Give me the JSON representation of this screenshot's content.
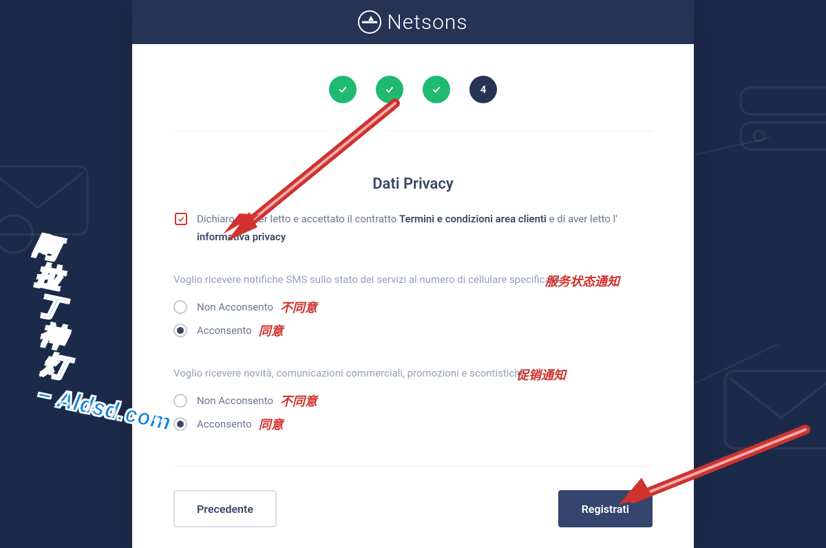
{
  "brand": "Netsons",
  "steps": {
    "current": "4"
  },
  "title": "Dati Privacy",
  "terms": {
    "pre": "Dichiaro di aver letto e accettato il contratto ",
    "link1": "Termini e condizioni area clienti",
    "mid": " e di aver letto l' ",
    "link2": "informativa privacy"
  },
  "q1": {
    "text": "Voglio ricevere notifiche SMS sullo stato dei servizi al numero di cellulare specificato.",
    "annot": "服务状态通知",
    "opt_no": "Non Acconsento",
    "opt_no_annot": "不同意",
    "opt_yes": "Acconsento",
    "opt_yes_annot": "同意"
  },
  "q2": {
    "text": "Voglio ricevere novità, comunicazioni commerciali, promozioni e scontistiche.",
    "annot": "促销通知",
    "opt_no": "Non Acconsento",
    "opt_no_annot": "不同意",
    "opt_yes": "Acconsento",
    "opt_yes_annot": "同意"
  },
  "buttons": {
    "prev": "Precedente",
    "next": "Registrati"
  },
  "watermark": {
    "cn": "阿拉丁神灯",
    "sep": " – ",
    "dom": "Aldsd.com"
  },
  "colors": {
    "accent": "#d0322d",
    "brand_bg": "#263354",
    "green": "#1dba6f"
  }
}
